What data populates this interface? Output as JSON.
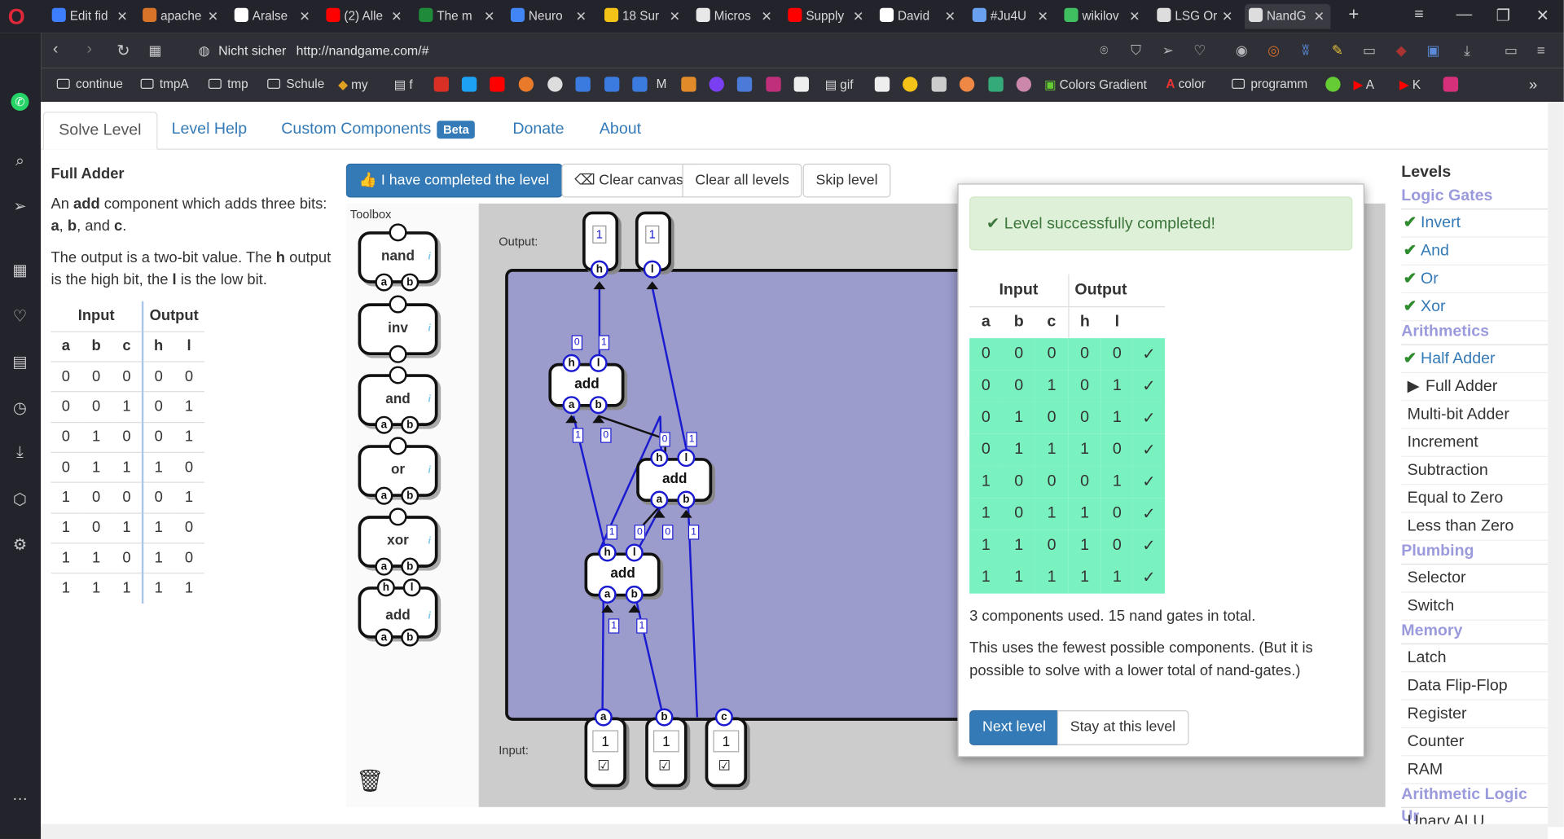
{
  "browser": {
    "tabs": [
      {
        "label": "Edit fid",
        "color": "#3d7eff"
      },
      {
        "label": "apache",
        "color": "#d8732a"
      },
      {
        "label": "Aralse",
        "color": "#ffffff"
      },
      {
        "label": "(2) Alle",
        "color": "#ff0000"
      },
      {
        "label": "The m",
        "color": "#1e8a3a"
      },
      {
        "label": "Neuro",
        "color": "#4285f4"
      },
      {
        "label": "18 Sur",
        "color": "#f3c317"
      },
      {
        "label": "Micros",
        "color": "#e8e8e8"
      },
      {
        "label": "Supply",
        "color": "#ff0000"
      },
      {
        "label": "David",
        "color": "#ffffff"
      },
      {
        "label": "#Ju4U",
        "color": "#6aa0f0"
      },
      {
        "label": "wikilov",
        "color": "#3fbf5f"
      },
      {
        "label": "LSG Or",
        "color": "#dddddd"
      },
      {
        "label": "NandG",
        "color": "#dddddd"
      }
    ],
    "address": {
      "security": "Nicht sicher",
      "url": "http://nandgame.com/#"
    },
    "bookmarks": {
      "continue": "continue",
      "tmpA": "tmpA",
      "tmp": "tmp",
      "schule": "Schule",
      "my": "my",
      "f": "f",
      "m": "M",
      "gif": "gif",
      "colors": "Colors Gradient",
      "color": "color",
      "programm": "programm",
      "a": "A",
      "k": "K",
      "more": "»"
    }
  },
  "nav": {
    "solve": "Solve Level",
    "help": "Level Help",
    "custom": "Custom Components",
    "beta": "Beta",
    "donate": "Donate",
    "about": "About"
  },
  "description": {
    "title": "Full Adder",
    "p1_pre": "An ",
    "p1_bold": "add",
    "p1_mid": " component which adds three bits: ",
    "p1_a": "a",
    "p1_sep1": ", ",
    "p1_b": "b",
    "p1_sep2": ", and ",
    "p1_c": "c",
    "p1_end": ".",
    "p2_pre": "The output is a two-bit value. The ",
    "p2_h": "h",
    "p2_mid": " output is the high bit, the ",
    "p2_l": "l",
    "p2_end": " is the low bit.",
    "table": {
      "group_input": "Input",
      "group_output": "Output",
      "headers": [
        "a",
        "b",
        "c",
        "h",
        "l"
      ],
      "rows": [
        [
          "0",
          "0",
          "0",
          "0",
          "0"
        ],
        [
          "0",
          "0",
          "1",
          "0",
          "1"
        ],
        [
          "0",
          "1",
          "0",
          "0",
          "1"
        ],
        [
          "0",
          "1",
          "1",
          "1",
          "0"
        ],
        [
          "1",
          "0",
          "0",
          "0",
          "1"
        ],
        [
          "1",
          "0",
          "1",
          "1",
          "0"
        ],
        [
          "1",
          "1",
          "0",
          "1",
          "0"
        ],
        [
          "1",
          "1",
          "1",
          "1",
          "1"
        ]
      ]
    }
  },
  "toolbar": {
    "completed": "I have completed the level",
    "clear_canvas": "Clear canvas",
    "clear_all": "Clear all levels",
    "skip": "Skip level"
  },
  "toolbox": {
    "label": "Toolbox",
    "items": [
      {
        "name": "nand",
        "pins_in": [
          "a",
          "b"
        ],
        "pins_out": [
          ""
        ]
      },
      {
        "name": "inv",
        "pins_in": [
          ""
        ],
        "pins_out": [
          ""
        ]
      },
      {
        "name": "and",
        "pins_in": [
          "a",
          "b"
        ],
        "pins_out": [
          ""
        ]
      },
      {
        "name": "or",
        "pins_in": [
          "a",
          "b"
        ],
        "pins_out": [
          ""
        ]
      },
      {
        "name": "xor",
        "pins_in": [
          "a",
          "b"
        ],
        "pins_out": [
          ""
        ]
      },
      {
        "name": "add",
        "pins_in": [
          "a",
          "b"
        ],
        "pins_out": [
          "h",
          "l"
        ]
      }
    ],
    "info": "i"
  },
  "canvas": {
    "output_label": "Output:",
    "input_label": "Input:",
    "outputs": [
      {
        "pin": "h",
        "value": "1"
      },
      {
        "pin": "l",
        "value": "1"
      }
    ],
    "inputs": [
      {
        "pin": "a",
        "value": "1",
        "checked": "☑"
      },
      {
        "pin": "b",
        "value": "1",
        "checked": "☑"
      },
      {
        "pin": "c",
        "value": "1",
        "checked": "☑"
      }
    ],
    "component_label": "add",
    "pin_labels": {
      "h": "h",
      "l": "l",
      "a": "a",
      "b": "b"
    },
    "wire_values": {
      "add1_out_h": "0",
      "add1_out_l": "1",
      "add1_in_a": "1",
      "add1_in_b": "0",
      "add2_out_h": "0",
      "add2_out_l": "1",
      "add2_in_a": "0",
      "add2_in_b": "1",
      "add3_out_h": "1",
      "add3_out_l": "0",
      "add3_in_a": "1",
      "add3_in_b": "1"
    }
  },
  "modal": {
    "success": "Level successfully completed!",
    "table": {
      "group_input": "Input",
      "group_output": "Output",
      "headers": [
        "a",
        "b",
        "c",
        "h",
        "l"
      ],
      "check": "✓",
      "rows": [
        [
          "0",
          "0",
          "0",
          "0",
          "0"
        ],
        [
          "0",
          "0",
          "1",
          "0",
          "1"
        ],
        [
          "0",
          "1",
          "0",
          "0",
          "1"
        ],
        [
          "0",
          "1",
          "1",
          "1",
          "0"
        ],
        [
          "1",
          "0",
          "0",
          "0",
          "1"
        ],
        [
          "1",
          "0",
          "1",
          "1",
          "0"
        ],
        [
          "1",
          "1",
          "0",
          "1",
          "0"
        ],
        [
          "1",
          "1",
          "1",
          "1",
          "1"
        ]
      ]
    },
    "stats": "3 components used. 15 nand gates in total.",
    "note": "This uses the fewest possible components. (But it is possible to solve with a lower total of nand-gates.)",
    "next": "Next level",
    "stay": "Stay at this level",
    "colors": {
      "ok": "#79f2c0",
      "success_bg": "#dff0d8"
    }
  },
  "levels": {
    "title": "Levels",
    "groups": [
      {
        "name": "Logic Gates",
        "items": [
          {
            "label": "Invert",
            "state": "done"
          },
          {
            "label": "And",
            "state": "done"
          },
          {
            "label": "Or",
            "state": "done"
          },
          {
            "label": "Xor",
            "state": "done"
          }
        ]
      },
      {
        "name": "Arithmetics",
        "items": [
          {
            "label": "Half Adder",
            "state": "done"
          },
          {
            "label": "Full Adder",
            "state": "current"
          },
          {
            "label": "Multi-bit Adder",
            "state": "todo"
          },
          {
            "label": "Increment",
            "state": "todo"
          },
          {
            "label": "Subtraction",
            "state": "todo"
          },
          {
            "label": "Equal to Zero",
            "state": "todo"
          },
          {
            "label": "Less than Zero",
            "state": "todo"
          }
        ]
      },
      {
        "name": "Plumbing",
        "items": [
          {
            "label": "Selector",
            "state": "todo"
          },
          {
            "label": "Switch",
            "state": "todo"
          }
        ]
      },
      {
        "name": "Memory",
        "items": [
          {
            "label": "Latch",
            "state": "todo"
          },
          {
            "label": "Data Flip-Flop",
            "state": "todo"
          },
          {
            "label": "Register",
            "state": "todo"
          },
          {
            "label": "Counter",
            "state": "todo"
          },
          {
            "label": "RAM",
            "state": "todo"
          }
        ]
      },
      {
        "name": "Arithmetic Logic Ur",
        "items": [
          {
            "label": "Unary ALU",
            "state": "todo"
          }
        ]
      }
    ],
    "done_mark": "✔",
    "current_mark": "▶"
  }
}
